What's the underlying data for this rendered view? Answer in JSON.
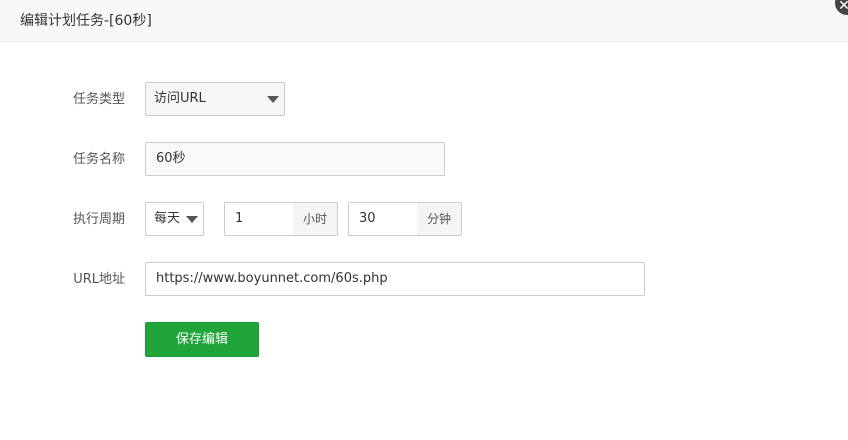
{
  "dialog": {
    "title": "编辑计划任务-[60秒]",
    "close_glyph": "✕"
  },
  "form": {
    "task_type": {
      "label": "任务类型",
      "value": "访问URL"
    },
    "task_name": {
      "label": "任务名称",
      "value": "60秒"
    },
    "cycle": {
      "label": "执行周期",
      "period_value": "每天",
      "hour_value": "1",
      "hour_unit": "小时",
      "minute_value": "30",
      "minute_unit": "分钟"
    },
    "url": {
      "label": "URL地址",
      "value": "https://www.boyunnet.com/60s.php"
    },
    "save_label": "保存编辑"
  },
  "colors": {
    "save_button": "#20a53a",
    "title_bar": "#f8f8f8"
  }
}
